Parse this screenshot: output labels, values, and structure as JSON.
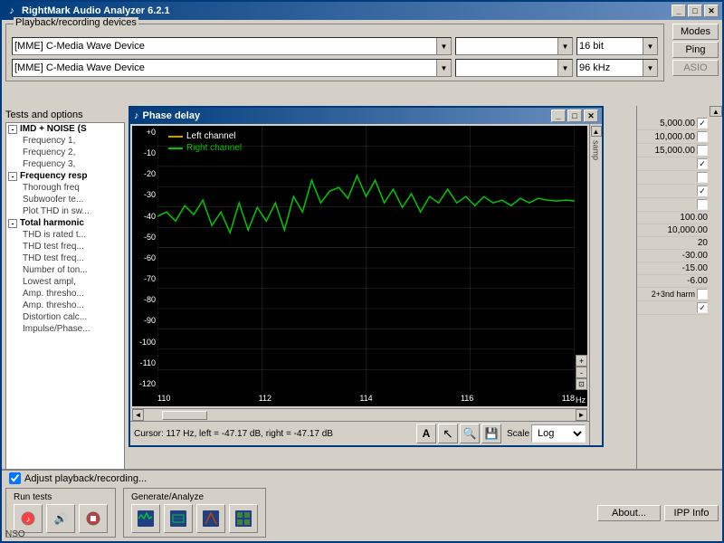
{
  "app": {
    "title": "RightMark Audio Analyzer 6.2.1",
    "title_icon": "♪"
  },
  "title_buttons": {
    "minimize": "_",
    "maximize": "□",
    "close": "✕"
  },
  "playback_group": {
    "label": "Playback/recording devices",
    "device1": "[MME] C-Media Wave Device",
    "device2": "[MME] C-Media Wave Device",
    "bitdepth": "16 bit",
    "samplerate": "96 kHz",
    "modes_btn": "Modes",
    "ping_btn": "Ping",
    "asio_btn": "ASIO"
  },
  "tests_label": "Tests and options",
  "tree": {
    "imd_noise": "IMD + NOISE (S",
    "freq1": "Frequency 1,",
    "freq2": "Frequency 2,",
    "freq3": "Frequency 3,",
    "freq_resp": "Frequency resp",
    "thorough_freq": "Thorough freq",
    "subwoofer": "Subwoofer te...",
    "plot_thd": "Plot THD in sw...",
    "total_harmonic": "Total harmonic",
    "thd_rated": "THD is rated t...",
    "thd_test1": "THD test freq...",
    "thd_test2": "THD test freq...",
    "num_tones": "Number of ton...",
    "lowest_ampl": "Lowest ampl,",
    "amp_thresh1": "Amp. thresho...",
    "amp_thresh2": "Amp. thresho...",
    "dist_calc": "Distortion calc...",
    "impulse": "Impulse/Phase..."
  },
  "phase_delay": {
    "title": "Phase delay",
    "title_icon": "♪",
    "legend": {
      "left": "Left channel",
      "right": "Right channel"
    },
    "y_labels": [
      "+0",
      "-10",
      "-20",
      "-30",
      "-40",
      "-50",
      "-60",
      "-70",
      "-80",
      "-90",
      "-100",
      "-110",
      "-120"
    ],
    "x_labels": [
      "110",
      "112",
      "114",
      "116",
      "118"
    ],
    "hz_label": "Hz",
    "cursor_status": "Cursor: 117 Hz, left = -47.17 dB, right = -47.17 dB",
    "scale_label": "Scale",
    "scale_value": "Log"
  },
  "toolbar_icons": {
    "text": "A",
    "cursor": "↖",
    "search": "🔍",
    "save": "💾"
  },
  "adjust_checkbox": "Adjust playback/recording...",
  "run_tests": {
    "label": "Run tests",
    "play": "▶",
    "sound": "🔊",
    "stop": "⏹"
  },
  "generate": {
    "label": "Generate/Analyze",
    "btn1": "≋",
    "btn2": "⊞",
    "btn3": "⌘",
    "btn4": "⊟"
  },
  "buttons": {
    "about": "About...",
    "ipp": "IPP Info"
  },
  "nso": "NSO",
  "options_values": [
    {
      "value": "5,000.00",
      "checked": true
    },
    {
      "value": "10,000.00",
      "checked": false
    },
    {
      "value": "15,000.00",
      "checked": false
    },
    {
      "value": "",
      "checked": true
    },
    {
      "value": "",
      "checked": false
    },
    {
      "value": "",
      "checked": true
    },
    {
      "value": "",
      "checked": false
    },
    {
      "value": "100.00",
      "checked": false
    },
    {
      "value": "10,000.00",
      "checked": false
    },
    {
      "value": "20",
      "checked": false
    },
    {
      "value": "-30.00",
      "checked": false
    },
    {
      "value": "-15.00",
      "checked": false
    },
    {
      "value": "-6.00",
      "checked": false
    },
    {
      "value": "2+3nd harm",
      "checked": false
    },
    {
      "value": "",
      "checked": true
    }
  ],
  "samp_label": "samp"
}
